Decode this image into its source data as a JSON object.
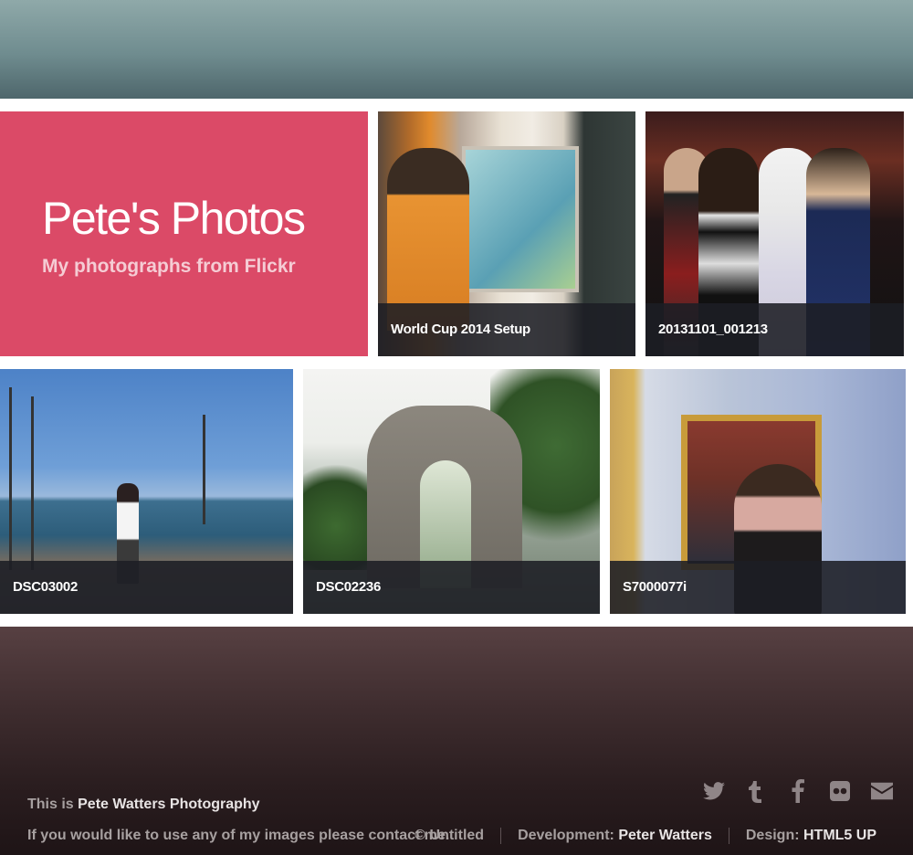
{
  "hero": {
    "title": "Pete's Photos",
    "subtitle": "My photographs from Flickr"
  },
  "photos": [
    {
      "caption": "World Cup 2014 Setup"
    },
    {
      "caption": "20131101_001213"
    },
    {
      "caption": "DSC03002"
    },
    {
      "caption": "DSC02236"
    },
    {
      "caption": "S7000077i"
    }
  ],
  "footer": {
    "intro_prefix": "This is ",
    "intro_name": "Pete Watters Photography",
    "contact_text": "If you would like to use any of my images please contact me.",
    "copyright": "© Untitled",
    "development_label": "Development: ",
    "development_name": "Peter Watters",
    "design_label": "Design: ",
    "design_name": "HTML5 UP",
    "social_icons": [
      "twitter-icon",
      "tumblr-icon",
      "facebook-icon",
      "flickr-icon",
      "email-icon"
    ]
  },
  "colors": {
    "hero_bg": "#db4a67",
    "caption_bg": "#1c1e24",
    "footer_text": "#a7a0a0"
  }
}
